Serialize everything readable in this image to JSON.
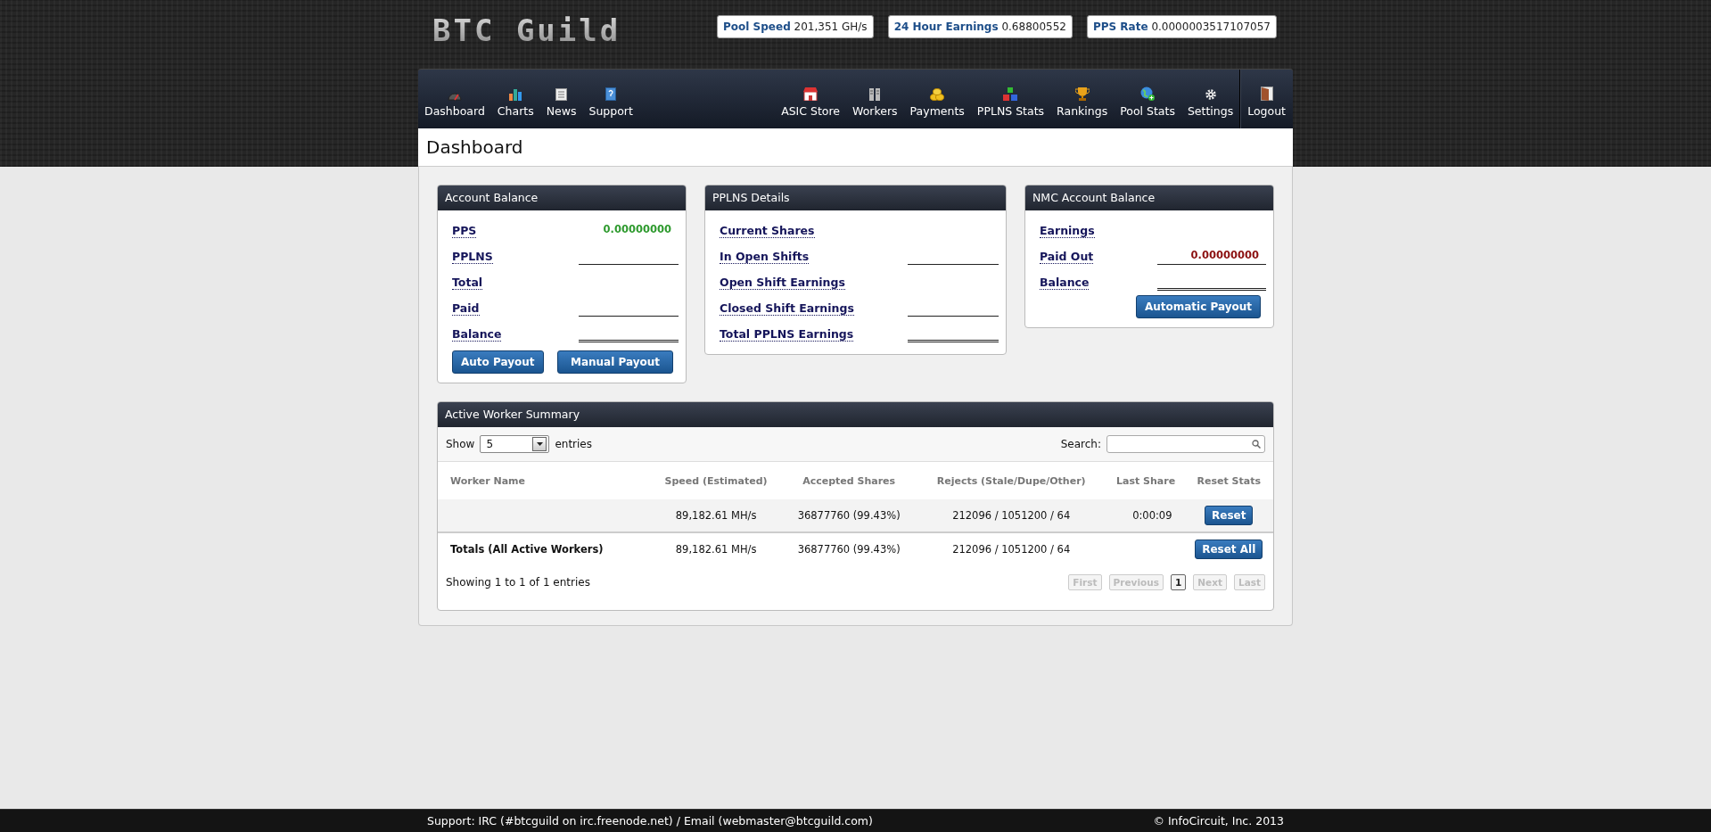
{
  "logo": "BTC Guild",
  "stats": [
    {
      "label": "Pool Speed",
      "value": "201,351 GH/s"
    },
    {
      "label": "24 Hour Earnings",
      "value": "0.68800552"
    },
    {
      "label": "PPS Rate",
      "value": "0.0000003517107057"
    }
  ],
  "nav": {
    "left": [
      {
        "label": "Dashboard"
      },
      {
        "label": "Charts"
      },
      {
        "label": "News"
      },
      {
        "label": "Support"
      }
    ],
    "right": [
      {
        "label": "ASIC Store"
      },
      {
        "label": "Workers"
      },
      {
        "label": "Payments"
      },
      {
        "label": "PPLNS Stats"
      },
      {
        "label": "Rankings"
      },
      {
        "label": "Pool Stats"
      },
      {
        "label": "Settings"
      }
    ],
    "logout": {
      "label": "Logout"
    }
  },
  "page_title": "Dashboard",
  "panels": [
    {
      "title": "Account Balance",
      "rows": [
        {
          "label": "PPS",
          "value": "0.00000000",
          "color": "#2e9a2e",
          "kind": "plain"
        },
        {
          "label": "PPLNS",
          "kind": "underlined"
        },
        {
          "label": "Total",
          "kind": "plain"
        },
        {
          "label": "Paid",
          "kind": "underlined"
        },
        {
          "label": "Balance",
          "kind": "double-underlined"
        }
      ],
      "buttons": [
        "Auto Payout",
        "Manual Payout"
      ]
    },
    {
      "title": "PPLNS Details",
      "rows": [
        {
          "label": "Current Shares",
          "kind": "plain"
        },
        {
          "label": "In Open Shifts",
          "kind": "underlined"
        },
        {
          "label": "Open Shift Earnings",
          "kind": "plain"
        },
        {
          "label": "Closed Shift Earnings",
          "kind": "underlined"
        },
        {
          "label": "Total PPLNS Earnings",
          "kind": "double-underlined"
        }
      ]
    },
    {
      "title": "NMC Account Balance",
      "rows": [
        {
          "label": "Earnings",
          "kind": "plain"
        },
        {
          "label": "Paid Out",
          "value": "0.00000000",
          "color": "#8b1010",
          "kind": "underlined"
        },
        {
          "label": "Balance",
          "kind": "double-underlined"
        }
      ],
      "buttons": [
        "Automatic Payout"
      ]
    }
  ],
  "workers": {
    "title": "Active Worker Summary",
    "show_label": "Show",
    "page_size": "5",
    "entries_label": "entries",
    "search_label": "Search:",
    "columns": [
      "Worker Name",
      "Speed (Estimated)",
      "Accepted Shares",
      "Rejects (Stale/Dupe/Other)",
      "Last Share",
      "Reset Stats"
    ],
    "rows": [
      {
        "cells": [
          "",
          "89,182.61 MH/s",
          "36877760 (99.43%)",
          "212096 / 1051200 / 64",
          "0:00:09"
        ],
        "button": "Reset"
      }
    ],
    "totals": {
      "cells": [
        "Totals (All Active Workers)",
        "89,182.61 MH/s",
        "36877760 (99.43%)",
        "212096 / 1051200 / 64",
        ""
      ],
      "button": "Reset All"
    },
    "info": "Showing 1 to 1 of 1 entries",
    "pager": [
      {
        "label": "First",
        "disabled": true,
        "selected": false
      },
      {
        "label": "Previous",
        "disabled": true,
        "selected": false
      },
      {
        "label": "1",
        "disabled": false,
        "selected": true
      },
      {
        "label": "Next",
        "disabled": true,
        "selected": false
      },
      {
        "label": "Last",
        "disabled": true,
        "selected": false
      }
    ]
  },
  "footer": {
    "support": "Support: IRC (#btcguild on irc.freenode.net) / Email (webmaster@btcguild.com)",
    "copyright": "© InfoCircuit, Inc. 2013"
  }
}
